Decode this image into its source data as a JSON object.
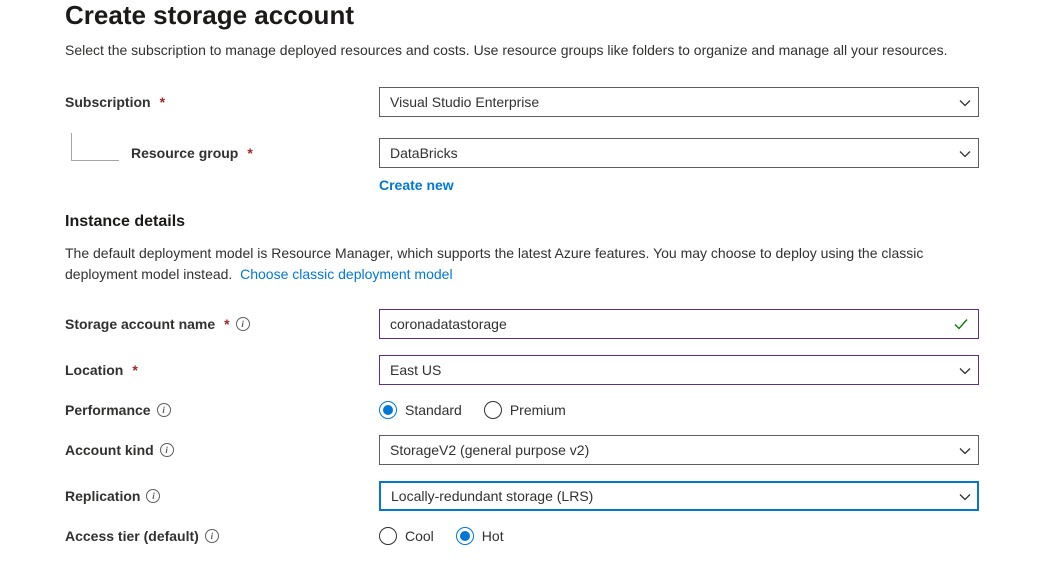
{
  "page": {
    "title": "Create storage account",
    "description": "Select the subscription to manage deployed resources and costs. Use resource groups like folders to organize and manage all your resources."
  },
  "subscription": {
    "label": "Subscription",
    "value": "Visual Studio Enterprise"
  },
  "resource_group": {
    "label": "Resource group",
    "value": "DataBricks",
    "create_new": "Create new"
  },
  "instance": {
    "section_title": "Instance details",
    "section_desc_1": "The default deployment model is Resource Manager, which supports the latest Azure features. You may choose to deploy using the classic deployment model instead.",
    "section_link": "Choose classic deployment model"
  },
  "storage_name": {
    "label": "Storage account name",
    "value": "coronadatastorage"
  },
  "location": {
    "label": "Location",
    "value": "East US"
  },
  "performance": {
    "label": "Performance",
    "options": {
      "standard": "Standard",
      "premium": "Premium"
    },
    "selected": "standard"
  },
  "account_kind": {
    "label": "Account kind",
    "value": "StorageV2 (general purpose v2)"
  },
  "replication": {
    "label": "Replication",
    "value": "Locally-redundant storage (LRS)"
  },
  "access_tier": {
    "label": "Access tier (default)",
    "options": {
      "cool": "Cool",
      "hot": "Hot"
    },
    "selected": "hot"
  }
}
